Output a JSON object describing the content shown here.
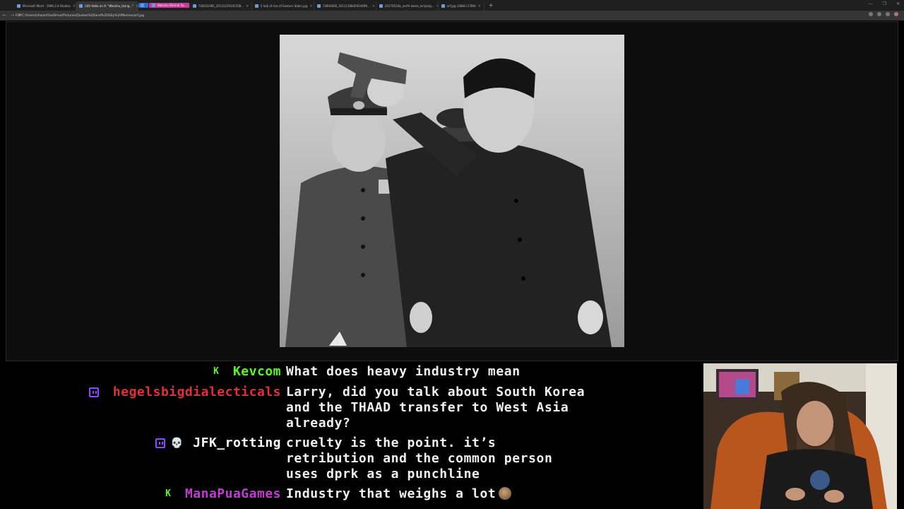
{
  "browser": {
    "tabs": [
      {
        "label": "Microsoft Word - 1990.2.4-Studies",
        "style": "normal"
      },
      {
        "label": "(36) Hello on X: \"Wanshu_Using...\"",
        "style": "active"
      },
      {
        "label": "",
        "style": "pill-blue"
      },
      {
        "label": "Wanshu Eternal Tu...",
        "style": "pill-pink"
      },
      {
        "label": "704431965_20131229161558...",
        "style": "normal"
      },
      {
        "label": "5 talk of rise of Eastern Stalin.jpg",
        "style": "normal"
      },
      {
        "label": "72893606_1611119845924499...",
        "style": "normal"
      },
      {
        "label": "20170524a_north-korea_kimjong...",
        "style": "normal"
      },
      {
        "label": "arf.jpg (1884×1789)",
        "style": "normal"
      }
    ],
    "new_tab": "+",
    "window_controls": [
      "—",
      "❐",
      "✕"
    ],
    "nav": [
      "←",
      "→",
      "⟳"
    ],
    "address": "File   C:/Users/shane/OneDrive/Pictures/Quotes%20and%20Silly%20Memes/arf.jpg"
  },
  "chat": {
    "messages": [
      {
        "platform": "kick",
        "badge_icon": "kick-icon",
        "badge": "K",
        "username": "Kevcom",
        "color": "#53fc18",
        "text": "What does heavy industry mean"
      },
      {
        "platform": "twitch",
        "badge_icon": "twitch-icon",
        "username": "hegelsbigdialecticals",
        "color": "#e0303a",
        "text": "Larry, did you talk about South Korea\nand the THAAD transfer to West Asia\nalready?"
      },
      {
        "platform": "twitch",
        "badge_icon": "twitch-icon",
        "extra_badge": "💀",
        "username": "JFK_rotting",
        "color": "#ffffff",
        "text": "cruelty is the point. it’s\nretribution and the common person\nuses dprk as a punchline"
      },
      {
        "platform": "kick",
        "badge_icon": "kick-icon",
        "badge": "K",
        "username": "ManaPuaGames",
        "color": "#c23bd4",
        "text": "Industry that weighs a lot",
        "emote": "emote-icon"
      }
    ]
  }
}
